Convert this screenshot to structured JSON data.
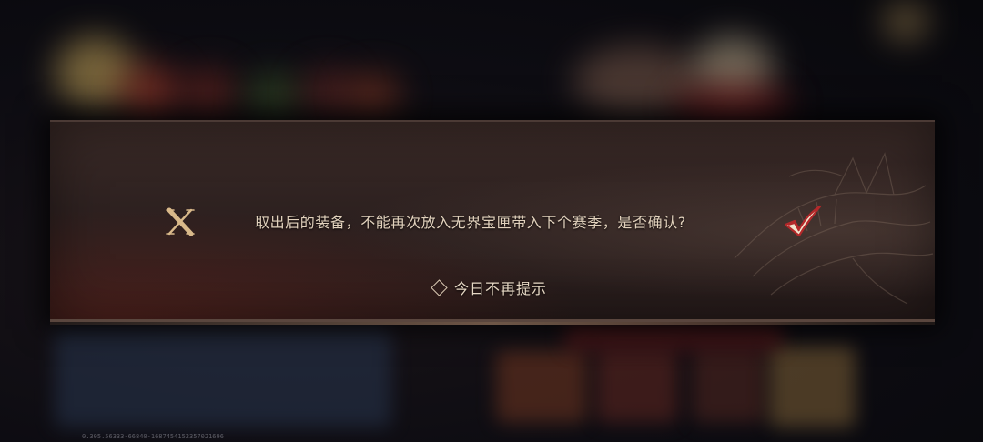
{
  "dialog": {
    "message": "取出后的装备，不能再次放入无界宝匣带入下个赛季，是否确认?",
    "dont_show_again_label": "今日不再提示",
    "close_icon": "x-close-icon",
    "confirm_icon": "checkmark-icon",
    "accent_color": "#d9b98a",
    "confirm_color": "#b3282a"
  },
  "footer": {
    "version_text": "0.305.56333-66840-1687454152357021696"
  }
}
